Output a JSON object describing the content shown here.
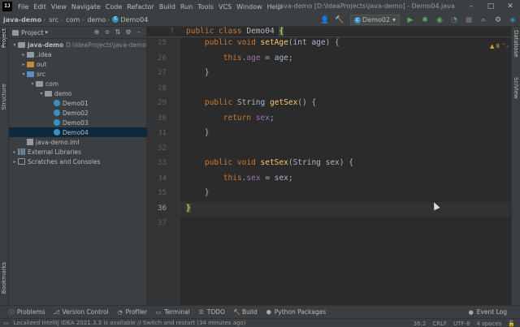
{
  "menu": {
    "items": [
      "File",
      "Edit",
      "View",
      "Navigate",
      "Code",
      "Refactor",
      "Build",
      "Run",
      "Tools",
      "VCS",
      "Window",
      "Help"
    ],
    "title": "java-demo [D:\\IdeaProjects\\java-demo] - Demo04.java"
  },
  "nav": {
    "crumbs": [
      "java-demo",
      "src",
      "com",
      "demo"
    ],
    "file": "Demo04",
    "run_config": "Demo02"
  },
  "left_strip": {
    "project": "Project",
    "structure": "Structure",
    "bookmarks": "Bookmarks"
  },
  "right_strip": {
    "database": "Database",
    "sciview": "SciView"
  },
  "project": {
    "title": "Project",
    "tree": [
      {
        "label": "java-demo",
        "note": "D:\\IdeaProjects\\java-demo",
        "indent": 0,
        "arrow": "▾",
        "icon": "folder"
      },
      {
        "label": ".idea",
        "indent": 1,
        "arrow": "▸",
        "icon": "folder"
      },
      {
        "label": "out",
        "indent": 1,
        "arrow": "▸",
        "icon": "folder-orange"
      },
      {
        "label": "src",
        "indent": 1,
        "arrow": "▾",
        "icon": "folder-blue"
      },
      {
        "label": "com",
        "indent": 2,
        "arrow": "▾",
        "icon": "folder"
      },
      {
        "label": "demo",
        "indent": 3,
        "arrow": "▾",
        "icon": "folder"
      },
      {
        "label": "Demo01",
        "indent": 4,
        "arrow": "",
        "icon": "class"
      },
      {
        "label": "Demo02",
        "indent": 4,
        "arrow": "",
        "icon": "class"
      },
      {
        "label": "Demo03",
        "indent": 4,
        "arrow": "",
        "icon": "class"
      },
      {
        "label": "Demo04",
        "indent": 4,
        "arrow": "",
        "icon": "class",
        "selected": true
      },
      {
        "label": "java-demo.iml",
        "indent": 1,
        "arrow": "",
        "icon": "iml"
      },
      {
        "label": "External Libraries",
        "indent": 0,
        "arrow": "▸",
        "icon": "lib"
      },
      {
        "label": "Scratches and Consoles",
        "indent": 0,
        "arrow": "▸",
        "icon": "scratch"
      }
    ]
  },
  "editor": {
    "sticky": {
      "line": "7",
      "text_kw": "public class",
      "text_name": "Demo04",
      "brace": "{"
    },
    "warnings": "▲ 8",
    "lines": [
      {
        "n": "25",
        "parts": [
          [
            "kw",
            "    public void "
          ],
          [
            "fn",
            "setAge"
          ],
          [
            "",
            "(int age) {"
          ]
        ]
      },
      {
        "n": "26",
        "parts": [
          [
            "",
            "        "
          ],
          [
            "kw",
            "this"
          ],
          [
            "",
            "."
          ],
          [
            "fld",
            "age"
          ],
          [
            "",
            " = age;"
          ]
        ]
      },
      {
        "n": "27",
        "parts": [
          [
            "",
            "    }"
          ]
        ]
      },
      {
        "n": "28",
        "parts": [
          [
            "",
            ""
          ]
        ]
      },
      {
        "n": "29",
        "parts": [
          [
            "kw",
            "    public "
          ],
          [
            "",
            "String "
          ],
          [
            "fn",
            "getSex"
          ],
          [
            "",
            "() {"
          ]
        ]
      },
      {
        "n": "30",
        "parts": [
          [
            "kw",
            "        return "
          ],
          [
            "fld",
            "sex"
          ],
          [
            "",
            ";"
          ]
        ]
      },
      {
        "n": "31",
        "parts": [
          [
            "",
            "    }"
          ]
        ]
      },
      {
        "n": "32",
        "parts": [
          [
            "",
            ""
          ]
        ]
      },
      {
        "n": "33",
        "parts": [
          [
            "kw",
            "    public void "
          ],
          [
            "fn",
            "setSex"
          ],
          [
            "",
            "(String sex) {"
          ]
        ]
      },
      {
        "n": "34",
        "parts": [
          [
            "",
            "        "
          ],
          [
            "kw",
            "this"
          ],
          [
            "",
            "."
          ],
          [
            "fld",
            "sex"
          ],
          [
            "",
            " = sex;"
          ]
        ]
      },
      {
        "n": "35",
        "parts": [
          [
            "",
            "    }"
          ]
        ]
      },
      {
        "n": "36",
        "parts": [
          [
            "brace",
            "}"
          ]
        ]
      },
      {
        "n": "37",
        "parts": [
          [
            "",
            ""
          ]
        ]
      }
    ],
    "current_line": "36"
  },
  "bottom_tabs": [
    "Problems",
    "Version Control",
    "Profiler",
    "Terminal",
    "TODO",
    "Build",
    "Python Packages"
  ],
  "event_log": "Event Log",
  "status": {
    "message": "Localized IntelliJ IDEA 2021.3.3 is available // Switch and restart (34 minutes ago)",
    "position": "36:2",
    "line_sep": "CRLF",
    "encoding": "UTF-8",
    "indent": "4 spaces"
  }
}
